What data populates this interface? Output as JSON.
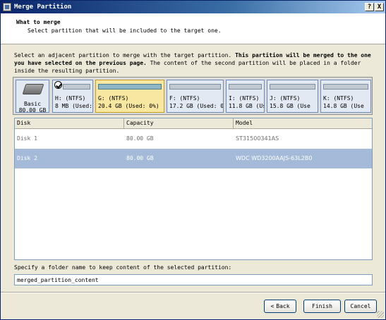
{
  "window": {
    "title": "Merge Partition",
    "help_label": "?",
    "close_label": "X"
  },
  "header": {
    "title": "What to merge",
    "subtitle": "Select partition that will be included to the target one."
  },
  "intro": {
    "part1": "Select an adjacent partition to merge with the target partition. ",
    "bold": "This partition will be merged to the one you have selected on the previous page.",
    "part2": " The content of the second partition will be placed in a folder inside the resulting partition."
  },
  "disk_strip": {
    "basic": {
      "type": "Basic",
      "size": "80.00 GB",
      "icon": "hard-disk-icon"
    },
    "partitions": [
      {
        "line1": "H: (NTFS)",
        "line2": "8 MB (Used:",
        "selected": false,
        "checked": true
      },
      {
        "line1": "G: (NTFS)",
        "line2": "20.4 GB (Used: 0%)",
        "selected": true,
        "checked": false
      },
      {
        "line1": "F: (NTFS)",
        "line2": "17.2 GB (Used: 0%",
        "selected": false,
        "checked": false
      },
      {
        "line1": "I: (NTFS)",
        "line2": "11.8 GB (Us",
        "selected": false,
        "checked": false
      },
      {
        "line1": "J: (NTFS)",
        "line2": "15.8 GB (Use",
        "selected": false,
        "checked": false
      },
      {
        "line1": "K: (NTFS)",
        "line2": "14.8 GB (Use",
        "selected": false,
        "checked": false
      }
    ]
  },
  "table": {
    "headers": [
      "Disk",
      "Capacity",
      "Model"
    ],
    "rows": [
      {
        "disk": "Disk 1",
        "capacity": "80.00 GB",
        "model": "ST31500341AS",
        "selected": false
      },
      {
        "disk": "Disk 2",
        "capacity": "80.00 GB",
        "model": "WDC WD3200AAJS-63L2B0",
        "selected": true
      }
    ]
  },
  "folder": {
    "label": "Specify a folder name to keep content of the selected partition:",
    "value": "merged_partition_content"
  },
  "buttons": {
    "back": "Back",
    "back_arrow": "<",
    "finish": "Finish",
    "cancel": "Cancel"
  }
}
